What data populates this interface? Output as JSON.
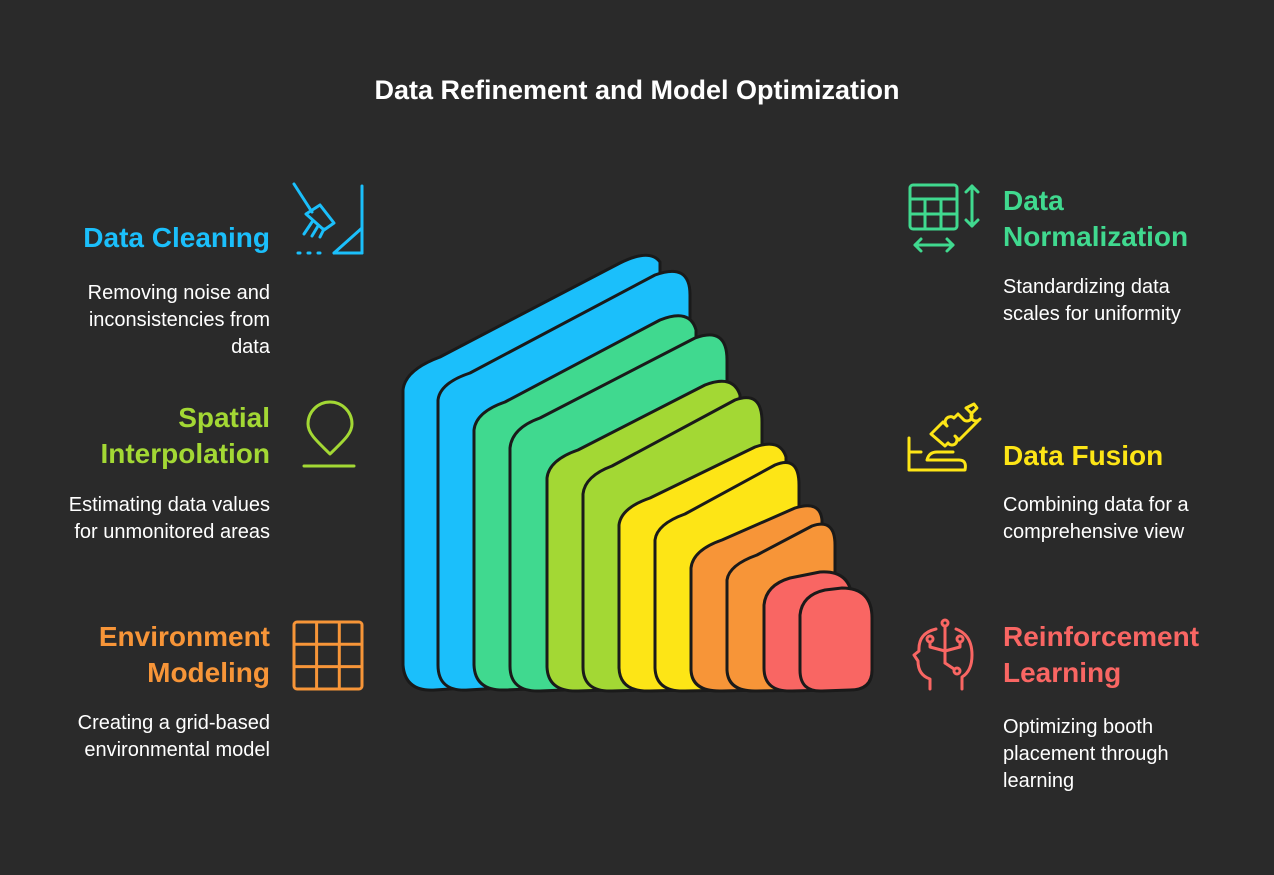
{
  "title": "Data Refinement and Model Optimization",
  "colors": {
    "background": "#2a2a2a",
    "blue": "#1bbffb",
    "green": "#40d98f",
    "lime": "#a3d834",
    "yellow": "#fde516",
    "orange": "#f79538",
    "red": "#f96663"
  },
  "items": [
    {
      "id": "data-cleaning",
      "title_lines": [
        "Data Cleaning"
      ],
      "desc_lines": [
        "Removing noise and",
        "inconsistencies from",
        "data"
      ],
      "color": "#1bbffb",
      "icon": "broom-icon"
    },
    {
      "id": "spatial-interpolation",
      "title_lines": [
        "Spatial",
        "Interpolation"
      ],
      "desc_lines": [
        "Estimating data values",
        "for unmonitored areas"
      ],
      "color": "#a3d834",
      "icon": "location-pin-icon"
    },
    {
      "id": "environment-modeling",
      "title_lines": [
        "Environment",
        "Modeling"
      ],
      "desc_lines": [
        "Creating a grid-based",
        "environmental model"
      ],
      "color": "#f79538",
      "icon": "grid-icon"
    },
    {
      "id": "data-normalization",
      "title_lines": [
        "Data",
        "Normalization"
      ],
      "desc_lines": [
        "Standardizing data",
        "scales for uniformity"
      ],
      "color": "#40d98f",
      "icon": "table-resize-icon"
    },
    {
      "id": "data-fusion",
      "title_lines": [
        "Data Fusion"
      ],
      "desc_lines": [
        "Combining data for a",
        "comprehensive view"
      ],
      "color": "#fde516",
      "icon": "puzzle-hand-icon"
    },
    {
      "id": "reinforcement-learning",
      "title_lines": [
        "Reinforcement",
        "Learning"
      ],
      "desc_lines": [
        "Optimizing booth",
        "placement through",
        "learning"
      ],
      "color": "#f96663",
      "icon": "brain-circuit-head-icon"
    }
  ]
}
